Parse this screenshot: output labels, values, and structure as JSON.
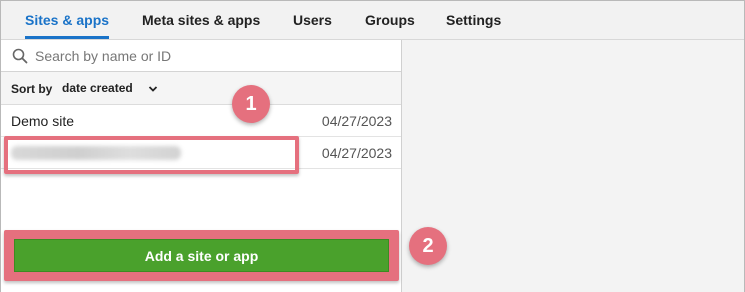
{
  "tabs": [
    {
      "label": "Sites & apps",
      "active": true
    },
    {
      "label": "Meta sites & apps",
      "active": false
    },
    {
      "label": "Users",
      "active": false
    },
    {
      "label": "Groups",
      "active": false
    },
    {
      "label": "Settings",
      "active": false
    }
  ],
  "search": {
    "placeholder": "Search by name or ID",
    "value": "",
    "icon": "search-icon"
  },
  "sort": {
    "label": "Sort by",
    "selected": "date created",
    "icon": "chevron-down-icon"
  },
  "sites": [
    {
      "name": "Demo site",
      "date": "04/27/2023"
    },
    {
      "name": "",
      "date": "04/27/2023",
      "name_blurred": true
    }
  ],
  "add_button": {
    "label": "Add a site or app"
  },
  "callouts": [
    {
      "number": "1"
    },
    {
      "number": "2"
    }
  ],
  "colors": {
    "accent": "#1a73c8",
    "callout": "#e5707e",
    "button": "#4aa12c"
  }
}
